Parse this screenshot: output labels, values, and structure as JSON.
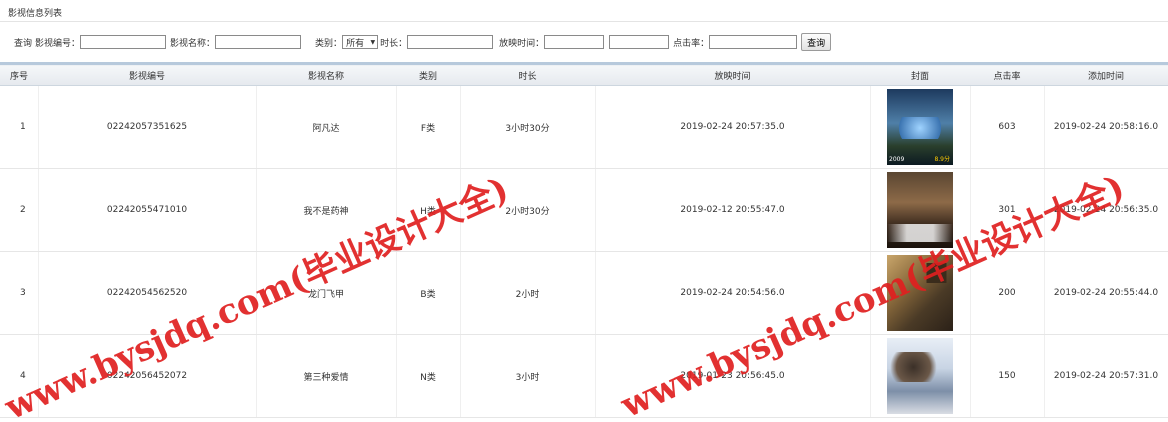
{
  "page": {
    "title": "影视信息列表"
  },
  "search": {
    "prefix": "查询",
    "code_label": "影视编号：",
    "code_value": "",
    "name_label": "影视名称：",
    "name_value": "",
    "category_label": "类别：",
    "category_value": "所有",
    "duration_label": "时长：",
    "duration_value": "",
    "showtime_label": "放映时间：",
    "showtime_from": "",
    "showtime_to": "",
    "clicks_label": "点击率：",
    "clicks_value": "",
    "submit_label": "查询"
  },
  "table": {
    "headers": [
      "序号",
      "影视编号",
      "影视名称",
      "类别",
      "时长",
      "放映时间",
      "封面",
      "点击率",
      "添加时间"
    ],
    "rows": [
      {
        "index": "1",
        "code": "02242057351625",
        "name": "阿凡达",
        "category": "F类",
        "duration": "3小时30分",
        "showtime": "2019-02-24 20:57:35.0",
        "cover": "poster-avatar",
        "clicks": "603",
        "added": "2019-02-24 20:58:16.0"
      },
      {
        "index": "2",
        "code": "02242055471010",
        "name": "我不是药神",
        "category": "H类",
        "duration": "2小时30分",
        "showtime": "2019-02-12 20:55:47.0",
        "cover": "poster-dying-to-survive",
        "clicks": "301",
        "added": "2019-02-24 20:56:35.0"
      },
      {
        "index": "3",
        "code": "02242054562520",
        "name": "龙门飞甲",
        "category": "B类",
        "duration": "2小时",
        "showtime": "2019-02-24 20:54:56.0",
        "cover": "poster-flying-swords",
        "clicks": "200",
        "added": "2019-02-24 20:55:44.0"
      },
      {
        "index": "4",
        "code": "02242056452072",
        "name": "第三种爱情",
        "category": "N类",
        "duration": "3小时",
        "showtime": "2019-01-23 20:56:45.0",
        "cover": "poster-third-love",
        "clicks": "150",
        "added": "2019-02-24 20:57:31.0"
      }
    ]
  },
  "poster_texts": {
    "avatar_year": "2009",
    "avatar_tag": "8.9分"
  },
  "watermark": {
    "text": "www.bysjdq.com(毕业设计大全)",
    "color": "#e02020"
  }
}
